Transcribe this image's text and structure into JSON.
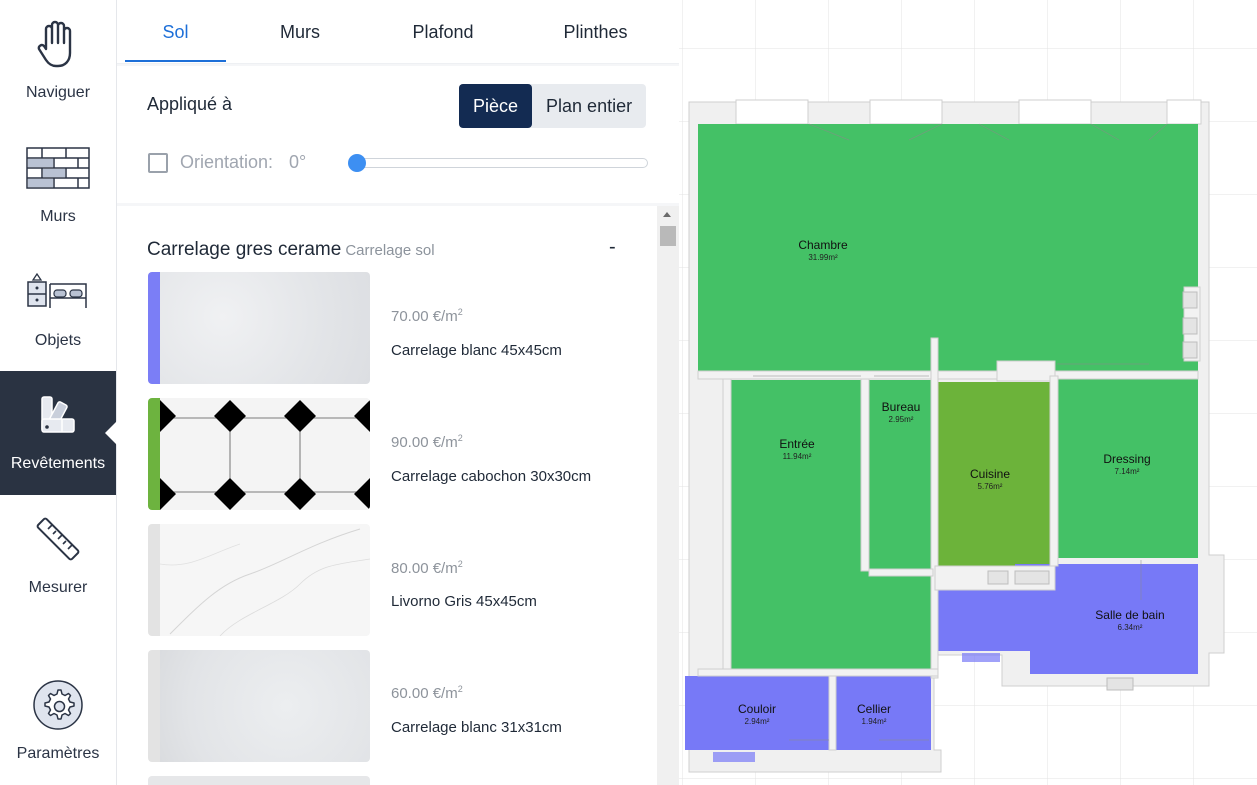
{
  "nav": [
    {
      "label": "Naviguer",
      "icon": "hand-icon"
    },
    {
      "label": "Murs",
      "icon": "brick-wall-icon"
    },
    {
      "label": "Objets",
      "icon": "furniture-icon"
    },
    {
      "label": "Revêtements",
      "icon": "swatches-icon",
      "active": true
    },
    {
      "label": "Mesurer",
      "icon": "ruler-icon"
    },
    {
      "label": "Paramètres",
      "icon": "gear-icon"
    }
  ],
  "tabs": [
    {
      "label": "Sol",
      "active": true
    },
    {
      "label": "Murs"
    },
    {
      "label": "Plafond"
    },
    {
      "label": "Plinthes"
    }
  ],
  "applied": {
    "label": "Appliqué à",
    "options": [
      "Pièce",
      "Plan entier"
    ],
    "selected": "Pièce"
  },
  "orientation": {
    "label": "Orientation:",
    "value": "0°",
    "checked": false,
    "slider_fraction": 0
  },
  "category": {
    "title": "Carrelage gres cerame",
    "subtitle": "Carrelage sol",
    "collapse": "-"
  },
  "products": [
    {
      "price": "70.00 €/m",
      "sup": "2",
      "name": "Carrelage blanc 45x45cm",
      "accent": "#7b7ef6"
    },
    {
      "price": "90.00 €/m",
      "sup": "2",
      "name": "Carrelage cabochon 30x30cm",
      "accent": "#6db33f"
    },
    {
      "price": "80.00 €/m",
      "sup": "2",
      "name": "Livorno Gris 45x45cm",
      "accent": "#e3e3e3"
    },
    {
      "price": "60.00 €/m",
      "sup": "2",
      "name": "Carrelage blanc 31x31cm",
      "accent": "#e3e3e3"
    }
  ],
  "rooms": [
    {
      "name": "Chambre",
      "area": "31.99m²",
      "color": "#44c166"
    },
    {
      "name": "Bureau",
      "area": "2.95m²",
      "color": "#44c166"
    },
    {
      "name": "Entrée",
      "area": "11.94m²",
      "color": "#44c166"
    },
    {
      "name": "Cuisine",
      "area": "5.76m²",
      "color": "#6cb33a"
    },
    {
      "name": "Dressing",
      "area": "7.14m²",
      "color": "#44c166"
    },
    {
      "name": "Salle de bain",
      "area": "6.34m²",
      "color": "#7779f7"
    },
    {
      "name": "Couloir",
      "area": "2.94m²",
      "color": "#7779f7"
    },
    {
      "name": "Cellier",
      "area": "1.94m²",
      "color": "#7779f7"
    }
  ],
  "colors": {
    "accent": "#1d6fd8",
    "nav_active": "#2a3342",
    "segment_on": "#132b52"
  }
}
